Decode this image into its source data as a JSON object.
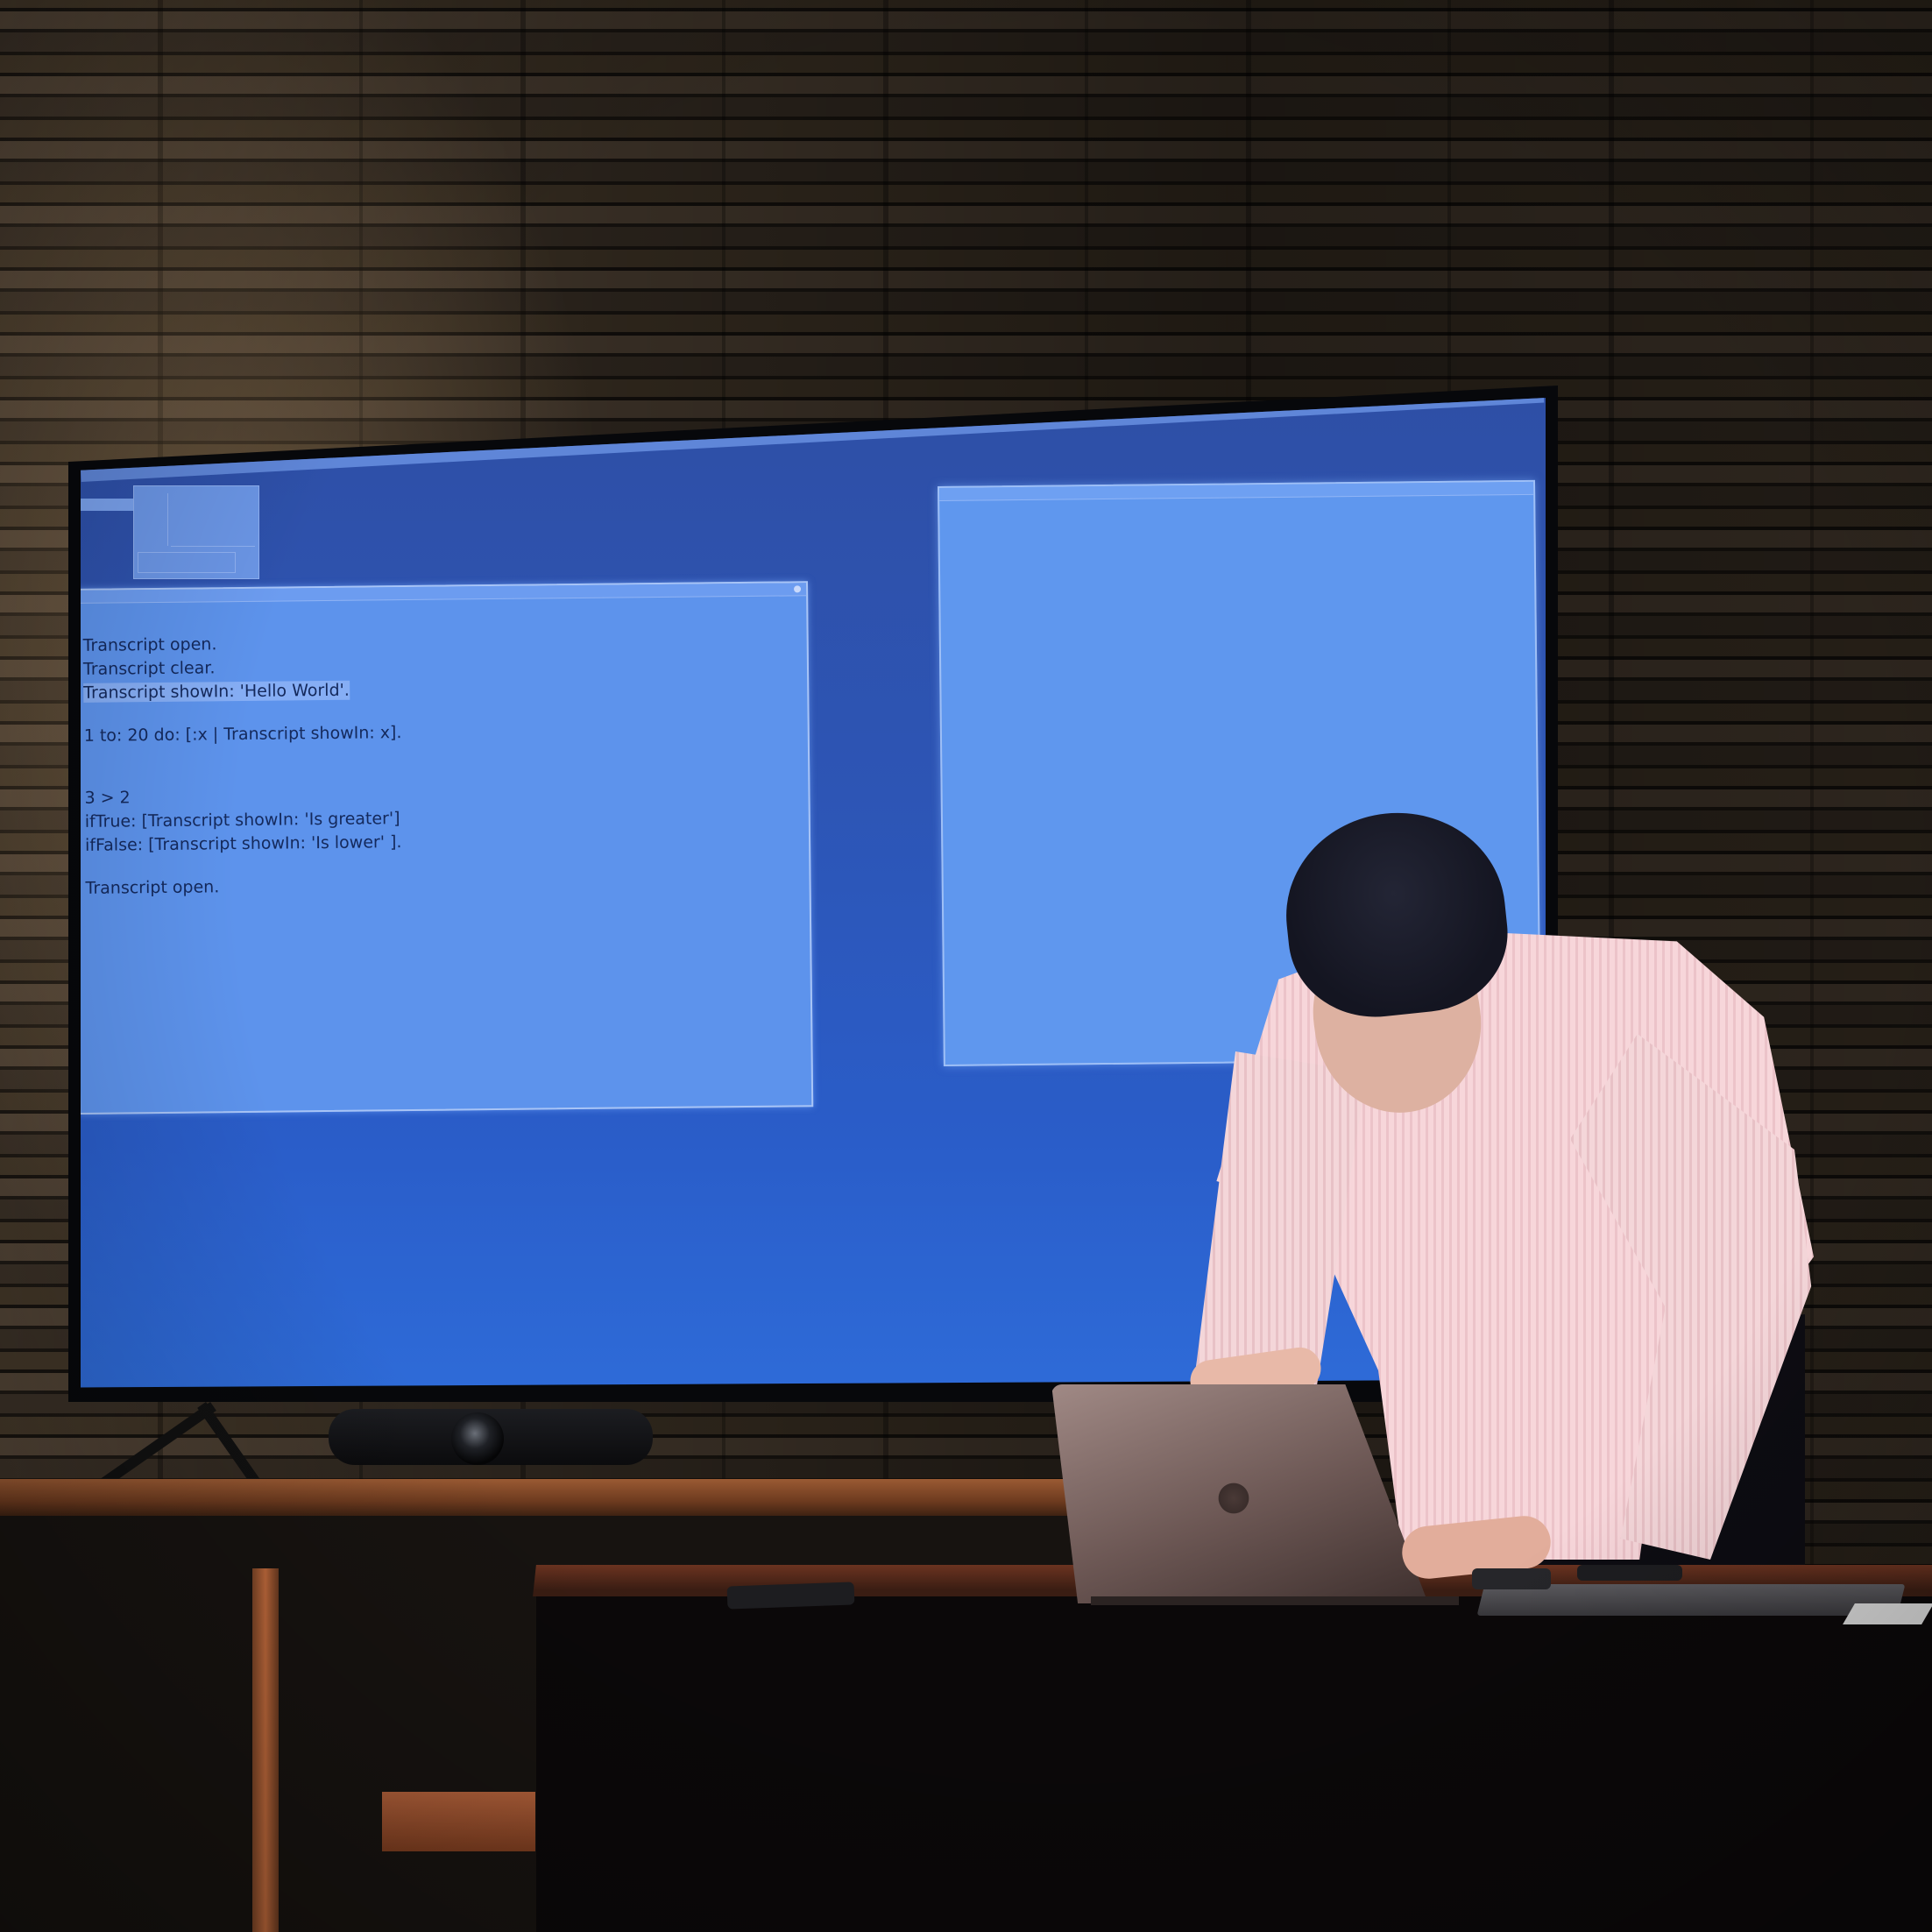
{
  "screen": {
    "menubar_items": [
      "",
      "",
      "",
      "",
      "",
      "",
      ""
    ],
    "clock": "",
    "playground": {
      "title": "",
      "code_lines": [
        "Transcript open.",
        "Transcript clear.",
        "Transcript showIn: 'Hello World'.",
        "",
        "1 to: 20 do: [:x | Transcript showIn: x].",
        "",
        "",
        "3 > 2",
        "ifTrue: [Transcript showIn: 'Is greater']",
        "ifFalse: [Transcript showIn: 'Is lower' ].",
        "",
        "Transcript open."
      ],
      "highlighted_line": 2
    },
    "transcript": {
      "title": ""
    }
  },
  "colors": {
    "screen_blue": "#2d55b5",
    "window_blue": "#5d93ec",
    "code_text": "#14295c",
    "shirt": "#f2d2d6",
    "wood": "#9a5a33"
  },
  "icons": [
    "apple-logo-icon",
    "window-close-icon"
  ]
}
